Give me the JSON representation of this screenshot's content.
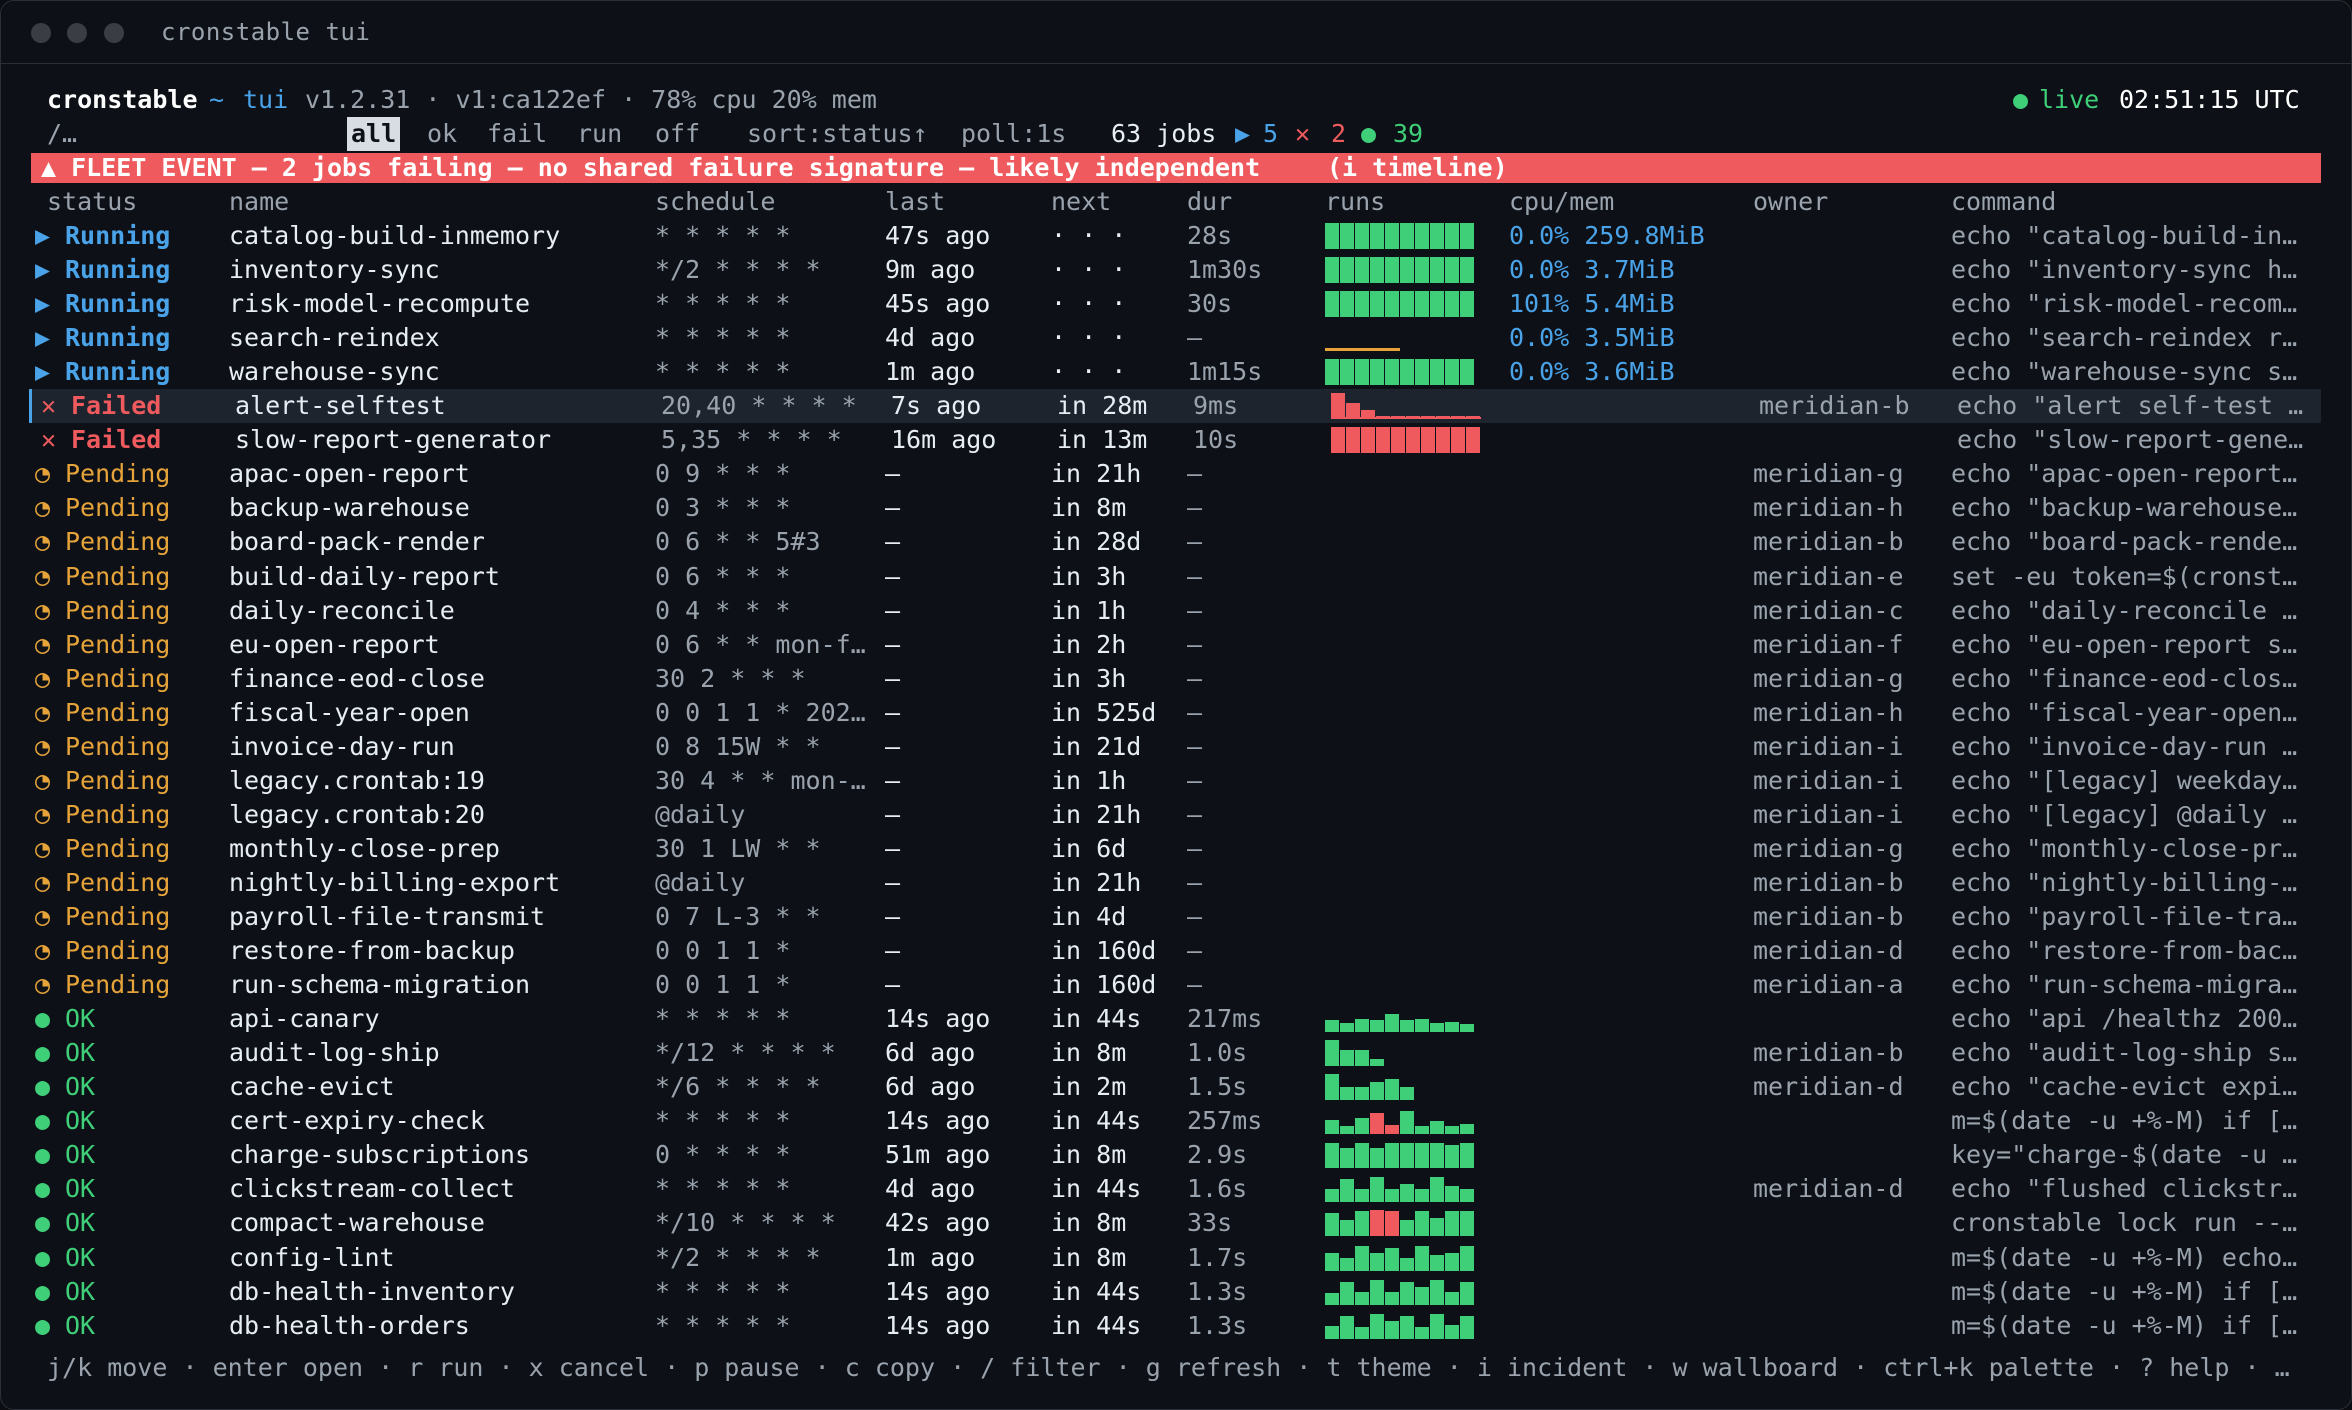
{
  "window": {
    "title": "cronstable tui"
  },
  "header": {
    "app": "cronstable",
    "tilde": "~",
    "mode": "tui",
    "meta": "v1.2.31 · v1:ca122ef · 78% cpu 20% mem",
    "live_label": "live",
    "clock": "02:51:15 UTC"
  },
  "filterbar": {
    "crumb": "/…",
    "tabs": [
      "all",
      "ok",
      "fail",
      "run",
      "off"
    ],
    "active_tab": "all",
    "sort": "sort:status↑",
    "poll": "poll:1s",
    "jobs_count": "63 jobs",
    "running_count": "5",
    "failed_count": "2",
    "ok_count": "39"
  },
  "banner": {
    "text": "▲ FLEET EVENT — 2 jobs failing — no shared failure signature — likely independent",
    "action": "(i timeline)"
  },
  "columns": [
    "status",
    "name",
    "schedule",
    "last",
    "next",
    "dur",
    "runs",
    "cpu/mem",
    "owner",
    "command"
  ],
  "rows": [
    {
      "status": "Running",
      "name": "catalog-build-inmemory",
      "schedule": "* * * * *",
      "last": "47s ago",
      "next": "· · ·",
      "dur": "28s",
      "runs": "full",
      "cpumem": "0.0% 259.8MiB",
      "owner": "",
      "command": "echo \"catalog-build-in…"
    },
    {
      "status": "Running",
      "name": "inventory-sync",
      "schedule": "*/2 * * * *",
      "last": "9m ago",
      "next": "· · ·",
      "dur": "1m30s",
      "runs": "full",
      "cpumem": "0.0% 3.7MiB",
      "owner": "",
      "command": "echo \"inventory-sync h…"
    },
    {
      "status": "Running",
      "name": "risk-model-recompute",
      "schedule": "* * * * *",
      "last": "45s ago",
      "next": "· · ·",
      "dur": "30s",
      "runs": "full",
      "cpumem": "101% 5.4MiB",
      "owner": "",
      "command": "echo \"risk-model-recom…"
    },
    {
      "status": "Running",
      "name": "search-reindex",
      "schedule": "* * * * *",
      "last": "4d ago",
      "next": "· · ·",
      "dur": "—",
      "runs": "low",
      "cpumem": "0.0% 3.5MiB",
      "owner": "",
      "command": "echo \"search-reindex r…"
    },
    {
      "status": "Running",
      "name": "warehouse-sync",
      "schedule": "* * * * *",
      "last": "1m ago",
      "next": "· · ·",
      "dur": "1m15s",
      "runs": "full",
      "cpumem": "0.0% 3.6MiB",
      "owner": "",
      "command": "echo \"warehouse-sync s…"
    },
    {
      "status": "Failed",
      "name": "alert-selftest",
      "schedule": "20,40 * * * *",
      "last": "7s ago",
      "next": "in 28m",
      "dur": "9ms",
      "runs": "failsmall",
      "cpumem": "",
      "owner": "meridian-b",
      "command": "echo \"alert self-test …"
    },
    {
      "status": "Failed",
      "name": "slow-report-generator",
      "schedule": "5,35 * * * *",
      "last": "16m ago",
      "next": "in 13m",
      "dur": "10s",
      "runs": "failfull",
      "cpumem": "",
      "owner": "",
      "command": "echo \"slow-report-gene…"
    },
    {
      "status": "Pending",
      "name": "apac-open-report",
      "schedule": "0 9 * * *",
      "last": "—",
      "next": "in 21h",
      "dur": "—",
      "runs": "",
      "cpumem": "",
      "owner": "meridian-g",
      "command": "echo \"apac-open-report…"
    },
    {
      "status": "Pending",
      "name": "backup-warehouse",
      "schedule": "0 3 * * *",
      "last": "—",
      "next": "in 8m",
      "dur": "—",
      "runs": "",
      "cpumem": "",
      "owner": "meridian-h",
      "command": "echo \"backup-warehouse…"
    },
    {
      "status": "Pending",
      "name": "board-pack-render",
      "schedule": "0 6 * * 5#3",
      "last": "—",
      "next": "in 28d",
      "dur": "—",
      "runs": "",
      "cpumem": "",
      "owner": "meridian-b",
      "command": "echo \"board-pack-rende…"
    },
    {
      "status": "Pending",
      "name": "build-daily-report",
      "schedule": "0 6 * * *",
      "last": "—",
      "next": "in 3h",
      "dur": "—",
      "runs": "",
      "cpumem": "",
      "owner": "meridian-e",
      "command": "set -eu token=$(cronst…"
    },
    {
      "status": "Pending",
      "name": "daily-reconcile",
      "schedule": "0 4 * * *",
      "last": "—",
      "next": "in 1h",
      "dur": "—",
      "runs": "",
      "cpumem": "",
      "owner": "meridian-c",
      "command": "echo \"daily-reconcile …"
    },
    {
      "status": "Pending",
      "name": "eu-open-report",
      "schedule": "0 6 * * mon-f…",
      "last": "—",
      "next": "in 2h",
      "dur": "—",
      "runs": "",
      "cpumem": "",
      "owner": "meridian-f",
      "command": "echo \"eu-open-report s…"
    },
    {
      "status": "Pending",
      "name": "finance-eod-close",
      "schedule": "30 2 * * *",
      "last": "—",
      "next": "in 3h",
      "dur": "—",
      "runs": "",
      "cpumem": "",
      "owner": "meridian-g",
      "command": "echo \"finance-eod-clos…"
    },
    {
      "status": "Pending",
      "name": "fiscal-year-open",
      "schedule": "0 0 1 1 * 202…",
      "last": "—",
      "next": "in 525d",
      "dur": "—",
      "runs": "",
      "cpumem": "",
      "owner": "meridian-h",
      "command": "echo \"fiscal-year-open…"
    },
    {
      "status": "Pending",
      "name": "invoice-day-run",
      "schedule": "0 8 15W * *",
      "last": "—",
      "next": "in 21d",
      "dur": "—",
      "runs": "",
      "cpumem": "",
      "owner": "meridian-i",
      "command": "echo \"invoice-day-run …"
    },
    {
      "status": "Pending",
      "name": "legacy.crontab:19",
      "schedule": "30 4 * * mon-…",
      "last": "—",
      "next": "in 1h",
      "dur": "—",
      "runs": "",
      "cpumem": "",
      "owner": "meridian-i",
      "command": "echo \"[legacy] weekday…"
    },
    {
      "status": "Pending",
      "name": "legacy.crontab:20",
      "schedule": "@daily",
      "last": "—",
      "next": "in 21h",
      "dur": "—",
      "runs": "",
      "cpumem": "",
      "owner": "meridian-i",
      "command": "echo \"[legacy] @daily …"
    },
    {
      "status": "Pending",
      "name": "monthly-close-prep",
      "schedule": "30 1 LW * *",
      "last": "—",
      "next": "in 6d",
      "dur": "—",
      "runs": "",
      "cpumem": "",
      "owner": "meridian-g",
      "command": "echo \"monthly-close-pr…"
    },
    {
      "status": "Pending",
      "name": "nightly-billing-export",
      "schedule": "@daily",
      "last": "—",
      "next": "in 21h",
      "dur": "—",
      "runs": "",
      "cpumem": "",
      "owner": "meridian-b",
      "command": "echo \"nightly-billing-…"
    },
    {
      "status": "Pending",
      "name": "payroll-file-transmit",
      "schedule": "0 7 L-3 * *",
      "last": "—",
      "next": "in 4d",
      "dur": "—",
      "runs": "",
      "cpumem": "",
      "owner": "meridian-b",
      "command": "echo \"payroll-file-tra…"
    },
    {
      "status": "Pending",
      "name": "restore-from-backup",
      "schedule": "0 0 1 1 *",
      "last": "—",
      "next": "in 160d",
      "dur": "—",
      "runs": "",
      "cpumem": "",
      "owner": "meridian-d",
      "command": "echo \"restore-from-bac…"
    },
    {
      "status": "Pending",
      "name": "run-schema-migration",
      "schedule": "0 0 1 1 *",
      "last": "—",
      "next": "in 160d",
      "dur": "—",
      "runs": "",
      "cpumem": "",
      "owner": "meridian-a",
      "command": "echo \"run-schema-migra…"
    },
    {
      "status": "OK",
      "name": "api-canary",
      "schedule": "* * * * *",
      "last": "14s ago",
      "next": "in 44s",
      "dur": "217ms",
      "runs": "ok1",
      "cpumem": "",
      "owner": "",
      "command": "echo \"api /healthz 200…"
    },
    {
      "status": "OK",
      "name": "audit-log-ship",
      "schedule": "*/12 * * * *",
      "last": "6d ago",
      "next": "in 8m",
      "dur": "1.0s",
      "runs": "ok2",
      "cpumem": "",
      "owner": "meridian-b",
      "command": "echo \"audit-log-ship s…"
    },
    {
      "status": "OK",
      "name": "cache-evict",
      "schedule": "*/6 * * * *",
      "last": "6d ago",
      "next": "in 2m",
      "dur": "1.5s",
      "runs": "ok3",
      "cpumem": "",
      "owner": "meridian-d",
      "command": "echo \"cache-evict expi…"
    },
    {
      "status": "OK",
      "name": "cert-expiry-check",
      "schedule": "* * * * *",
      "last": "14s ago",
      "next": "in 44s",
      "dur": "257ms",
      "runs": "ok4",
      "cpumem": "",
      "owner": "",
      "command": "m=$(date -u +%-M) if […"
    },
    {
      "status": "OK",
      "name": "charge-subscriptions",
      "schedule": "0 * * * *",
      "last": "51m ago",
      "next": "in 8m",
      "dur": "2.9s",
      "runs": "ok5",
      "cpumem": "",
      "owner": "",
      "command": "key=\"charge-$(date -u …"
    },
    {
      "status": "OK",
      "name": "clickstream-collect",
      "schedule": "* * * * *",
      "last": "4d ago",
      "next": "in 44s",
      "dur": "1.6s",
      "runs": "ok6",
      "cpumem": "",
      "owner": "meridian-d",
      "command": "echo \"flushed clickstr…"
    },
    {
      "status": "OK",
      "name": "compact-warehouse",
      "schedule": "*/10 * * * *",
      "last": "42s ago",
      "next": "in 8m",
      "dur": "33s",
      "runs": "ok7",
      "cpumem": "",
      "owner": "",
      "command": "cronstable lock run --…"
    },
    {
      "status": "OK",
      "name": "config-lint",
      "schedule": "*/2 * * * *",
      "last": "1m ago",
      "next": "in 8m",
      "dur": "1.7s",
      "runs": "ok8",
      "cpumem": "",
      "owner": "",
      "command": "m=$(date -u +%-M) echo…"
    },
    {
      "status": "OK",
      "name": "db-health-inventory",
      "schedule": "* * * * *",
      "last": "14s ago",
      "next": "in 44s",
      "dur": "1.3s",
      "runs": "ok9",
      "cpumem": "",
      "owner": "",
      "command": "m=$(date -u +%-M) if […"
    },
    {
      "status": "OK",
      "name": "db-health-orders",
      "schedule": "* * * * *",
      "last": "14s ago",
      "next": "in 44s",
      "dur": "1.3s",
      "runs": "ok10",
      "cpumem": "",
      "owner": "",
      "command": "m=$(date -u +%-M) if […"
    }
  ],
  "sparklines": {
    "full": [
      1,
      1,
      1,
      1,
      1,
      1,
      1,
      1,
      1,
      1
    ],
    "low": [
      0.12,
      0.12,
      0.12,
      0.12,
      0.12,
      0,
      0,
      0,
      0,
      0
    ],
    "failsmall": [
      1,
      0.6,
      0.35,
      0.1,
      0.1,
      0.1,
      0.1,
      0.1,
      0.1,
      0.1
    ],
    "failfull": [
      1,
      1,
      1,
      1,
      1,
      1,
      1,
      1,
      1,
      1
    ],
    "ok1": [
      0.45,
      0.35,
      0.5,
      0.45,
      0.7,
      0.45,
      0.5,
      0.35,
      0.4,
      0.3
    ],
    "ok2": [
      1,
      0.6,
      0.6,
      0.25,
      0,
      0,
      0,
      0,
      0,
      0
    ],
    "ok3": [
      1,
      0.5,
      0.5,
      0.7,
      0.8,
      0.5,
      0,
      0,
      0,
      0
    ],
    "ok4": [
      0.55,
      0.3,
      0.6,
      0.8,
      0.35,
      0.9,
      0.3,
      0.5,
      0.3,
      0.4
    ],
    "ok5": [
      0.95,
      0.75,
      0.95,
      0.75,
      0.95,
      0.95,
      0.95,
      0.95,
      0.9,
      0.95
    ],
    "ok6": [
      0.5,
      0.9,
      0.5,
      0.95,
      0.5,
      0.7,
      0.5,
      0.95,
      0.6,
      0.5
    ],
    "ok7": [
      0.9,
      0.6,
      0.95,
      1,
      0.95,
      0.6,
      0.95,
      0.7,
      0.95,
      0.95
    ],
    "ok8": [
      0.7,
      0.5,
      0.95,
      0.7,
      0.9,
      0.5,
      0.95,
      0.6,
      0.7,
      0.95
    ],
    "ok9": [
      0.45,
      0.9,
      0.5,
      0.95,
      0.5,
      0.9,
      0.7,
      0.95,
      0.5,
      0.9
    ],
    "ok10": [
      0.5,
      0.9,
      0.45,
      0.95,
      0.7,
      0.9,
      0.45,
      0.95,
      0.55,
      0.9
    ]
  },
  "sparkline_colors": {
    "ok4": [
      null,
      null,
      null,
      "#ee5a5d",
      "#ee5a5d",
      null,
      null,
      null,
      null,
      null
    ],
    "ok7": [
      null,
      null,
      null,
      "#ee5a5d",
      "#ee5a5d",
      null,
      null,
      null,
      null,
      null
    ]
  },
  "footer": "j/k move · enter open · r run · x cancel · p pause · c copy · / filter · g refresh · t theme · i incident · w wallboard · ctrl+k palette · ? help · …",
  "colors": {
    "ok": "#3fcf79",
    "fail": "#ee5a5d",
    "running": "#4aa3e8",
    "pending": "#e5a33a",
    "bg": "#0d1117"
  }
}
